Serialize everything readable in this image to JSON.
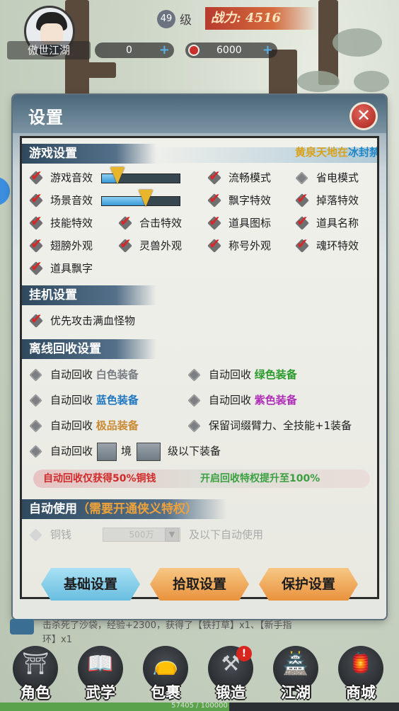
{
  "hud": {
    "player_name": "傲世江湖",
    "level": "49",
    "level_suffix": "级",
    "power_label": "战力: 4516",
    "currency_a": "0",
    "currency_b": "6000",
    "plus": "+"
  },
  "dialog": {
    "title": "设置",
    "close_glyph": "✕",
    "marquee_a": "黄泉天地在",
    "marquee_b": "冰封禁地"
  },
  "game_settings": {
    "header": "游戏设置",
    "music_label": "游戏音效",
    "music_level": 0.2,
    "scene_label": "场景音效",
    "scene_level": 0.55,
    "items": {
      "smooth": "流畅模式",
      "power_save": "省电模式",
      "float_text": "飘字特效",
      "drop_fx": "掉落特效",
      "skill_fx": "技能特效",
      "combo_fx": "合击特效",
      "item_icon": "道具图标",
      "item_name": "道具名称",
      "wing": "翅膀外观",
      "pet": "灵兽外观",
      "title_look": "称号外观",
      "soul_ring": "魂环特效",
      "item_float": "道具飘字"
    }
  },
  "idle_settings": {
    "header": "挂机设置",
    "priority": "优先攻击满血怪物"
  },
  "recycle_settings": {
    "header": "离线回收设置",
    "auto": "自动回收",
    "white": "白色装备",
    "green": "绿色装备",
    "blue": "蓝色装备",
    "purple": "紫色装备",
    "gold": "极品装备",
    "keep": "保留词缀臂力、全技能+1装备",
    "realm": "境",
    "below": "级以下装备",
    "notice_red": "自动回收仅获得50%铜钱",
    "notice_green": "开启回收特权提升至100%"
  },
  "auto_use": {
    "header": "自动使用",
    "note": "（需要开通侠义特权）",
    "item": "铜钱",
    "amount": "500万",
    "arrow": "▼",
    "suffix": "及以下自动使用"
  },
  "tabs": {
    "basic": "基础设置",
    "pickup": "拾取设置",
    "protect": "保护设置"
  },
  "chat": {
    "line1_prefix": "击杀死了沙袋，经验+2300，获得了【铁打草】x1、【新手指",
    "line2": "环】x1"
  },
  "nav": {
    "role": "角色",
    "martial": "武学",
    "bag": "包裹",
    "forge": "锻造",
    "jianghu": "江湖",
    "shop": "商城",
    "forge_badge": "!"
  },
  "exp": {
    "text": "57405 / 100000",
    "progress": 0.57405
  },
  "colors": {
    "accent_red": "#d62828",
    "tab_blue": "#68bde0",
    "tab_orange": "#e9923d"
  }
}
